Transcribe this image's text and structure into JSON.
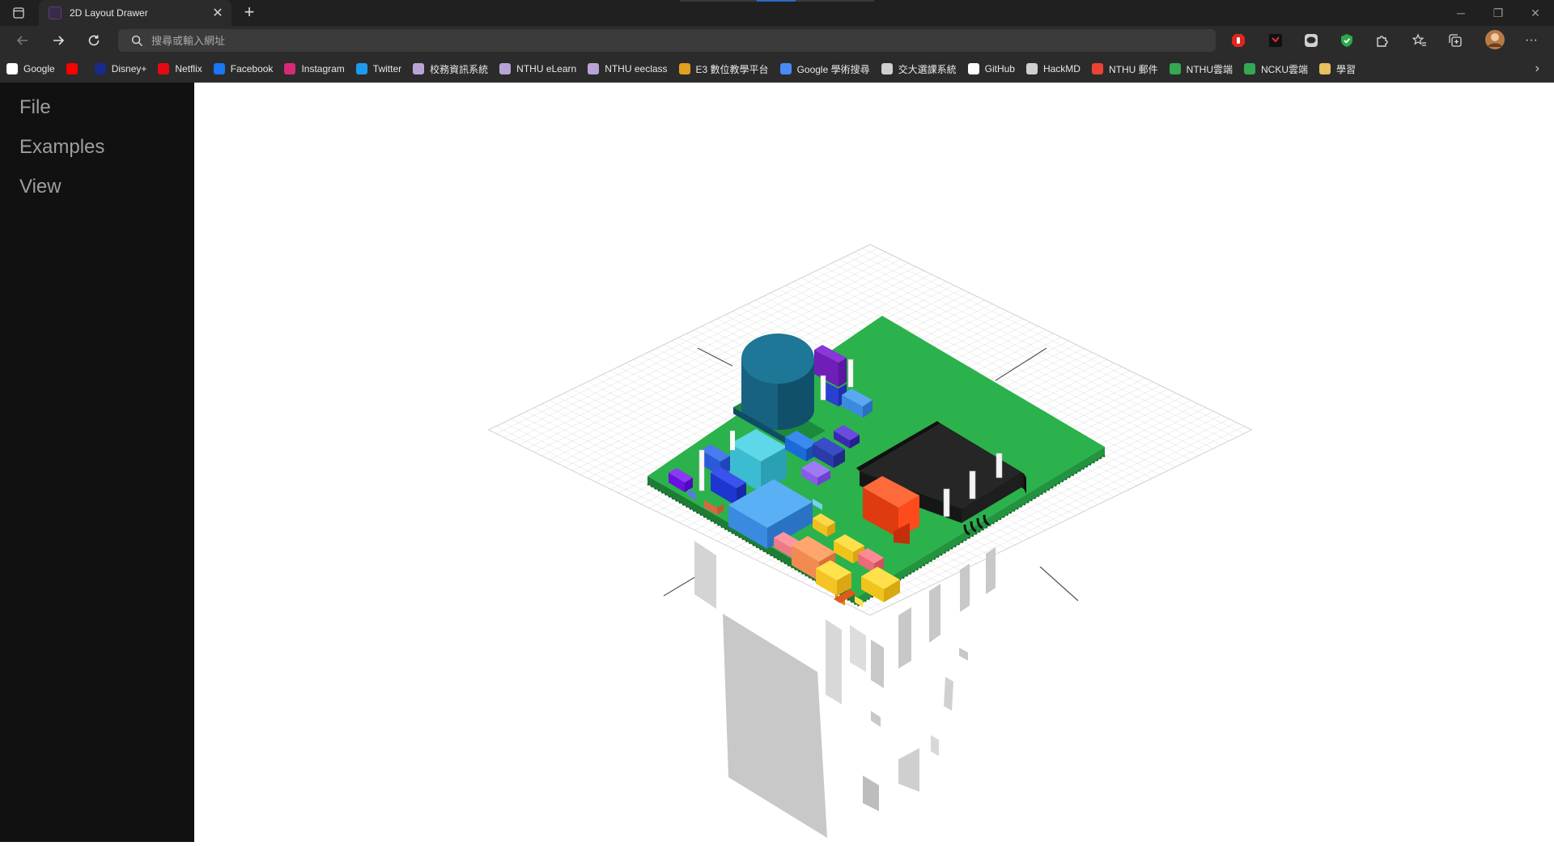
{
  "browser": {
    "tab_title": "2D Layout Drawer",
    "address_placeholder": "搜尋或輸入網址",
    "bookmarks": [
      {
        "label": "Google",
        "icon": "google-icon",
        "color": "#ffffff"
      },
      {
        "label": "",
        "icon": "youtube-icon",
        "color": "#ff0000"
      },
      {
        "label": "Disney+",
        "icon": "disney-plus-icon",
        "color": "#1a2a8c"
      },
      {
        "label": "Netflix",
        "icon": "netflix-icon",
        "color": "#e50914"
      },
      {
        "label": "Facebook",
        "icon": "facebook-icon",
        "color": "#1877f2"
      },
      {
        "label": "Instagram",
        "icon": "instagram-icon",
        "color": "#d62976"
      },
      {
        "label": "Twitter",
        "icon": "twitter-icon",
        "color": "#1d9bf0"
      },
      {
        "label": "校務資訊系統",
        "icon": "page-icon",
        "color": "#b9a3d6"
      },
      {
        "label": "NTHU eLearn",
        "icon": "page-icon",
        "color": "#b9a3d6"
      },
      {
        "label": "NTHU eeclass",
        "icon": "page-icon",
        "color": "#b9a3d6"
      },
      {
        "label": "E3 數位教學平台",
        "icon": "e3-icon",
        "color": "#e0a020"
      },
      {
        "label": "Google 學術搜尋",
        "icon": "scholar-icon",
        "color": "#4a8af4"
      },
      {
        "label": "交大選課系統",
        "icon": "document-icon",
        "color": "#d0d0d0"
      },
      {
        "label": "GitHub",
        "icon": "github-icon",
        "color": "#ffffff"
      },
      {
        "label": "HackMD",
        "icon": "hackmd-icon",
        "color": "#d0d0d0"
      },
      {
        "label": "NTHU 郵件",
        "icon": "gmail-icon",
        "color": "#ea4335"
      },
      {
        "label": "NTHU雲端",
        "icon": "drive-icon",
        "color": "#34a853"
      },
      {
        "label": "NCKU雲端",
        "icon": "drive-icon",
        "color": "#34a853"
      },
      {
        "label": "學習",
        "icon": "folder-icon",
        "color": "#e8c060"
      }
    ]
  },
  "app": {
    "menu": [
      "File",
      "Examples",
      "View"
    ]
  },
  "colors": {
    "pcb_green": "#2bb24c",
    "grid": "#d8d8d8",
    "capacitor": "#17627f",
    "ic_black": "#222222",
    "red_part": "#ff4a1c"
  }
}
